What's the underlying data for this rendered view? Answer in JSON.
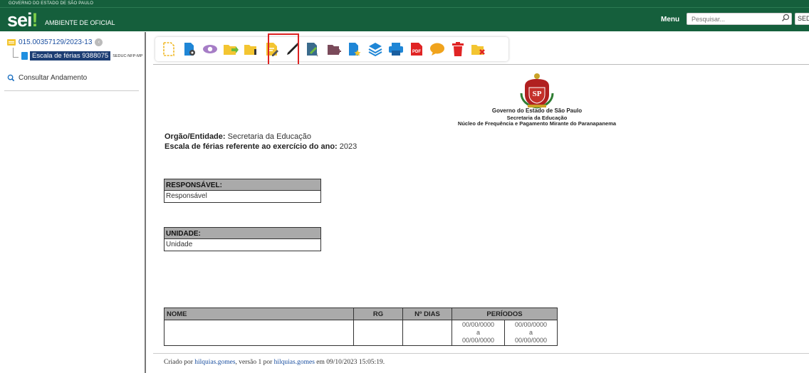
{
  "header": {
    "gov_bar": "GOVERNO DO ESTADO DE SÃO PAULO",
    "logo": "sei",
    "environment": "AMBIENTE DE OFICIAL",
    "menu_label": "Menu",
    "search_placeholder": "Pesquisar...",
    "unit": "SEDU"
  },
  "sidebar": {
    "process_number": "015.00357129/2023-13",
    "document_title": "Escala de férias 9388075",
    "document_unit": "SEDUC-NFP-MP",
    "consult_label": "Consultar Andamento"
  },
  "toolbar": {
    "icons": [
      "new-document-icon",
      "document-settings-icon",
      "view-icon",
      "send-process-icon",
      "info-folder-icon",
      "edit-content-icon",
      "sign-icon",
      "signature-block-icon",
      "attach-icon",
      "favorite-icon",
      "stack-icon",
      "print-icon",
      "pdf-icon",
      "comment-icon",
      "delete-icon",
      "cancel-icon"
    ],
    "highlighted": "edit-content-icon"
  },
  "document": {
    "gov_name": "Governo do Estado de São Paulo",
    "secretariat": "Secretaria da Educação",
    "nucleus": "Núcleo de Frequência e Pagamento Mirante do Paranapanema",
    "orgao_label": "Orgão/Entidade:",
    "orgao_value": "Secretaria da Educação",
    "escala_label": "Escala de férias referente ao exercício do ano:",
    "escala_year": "2023",
    "responsavel_header": "RESPONSÁVEL:",
    "responsavel_value": "Responsável",
    "unidade_header": "UNIDADE:",
    "unidade_value": "Unidade",
    "table": {
      "headers": [
        "NOME",
        "RG",
        "Nº DIAS",
        "PERÍODOS"
      ],
      "periods": [
        {
          "start": "00/00/0000",
          "sep": "a",
          "end": "00/00/0000"
        },
        {
          "start": "00/00/0000",
          "sep": "a",
          "end": "00/00/0000"
        }
      ]
    },
    "footer": {
      "created_by_label": "Criado por",
      "creator": "hilquias.gomes",
      "version_text": ", versão 1 por",
      "editor": "hilquias.gomes",
      "date_text": "em 09/10/2023 15:05:19."
    }
  }
}
